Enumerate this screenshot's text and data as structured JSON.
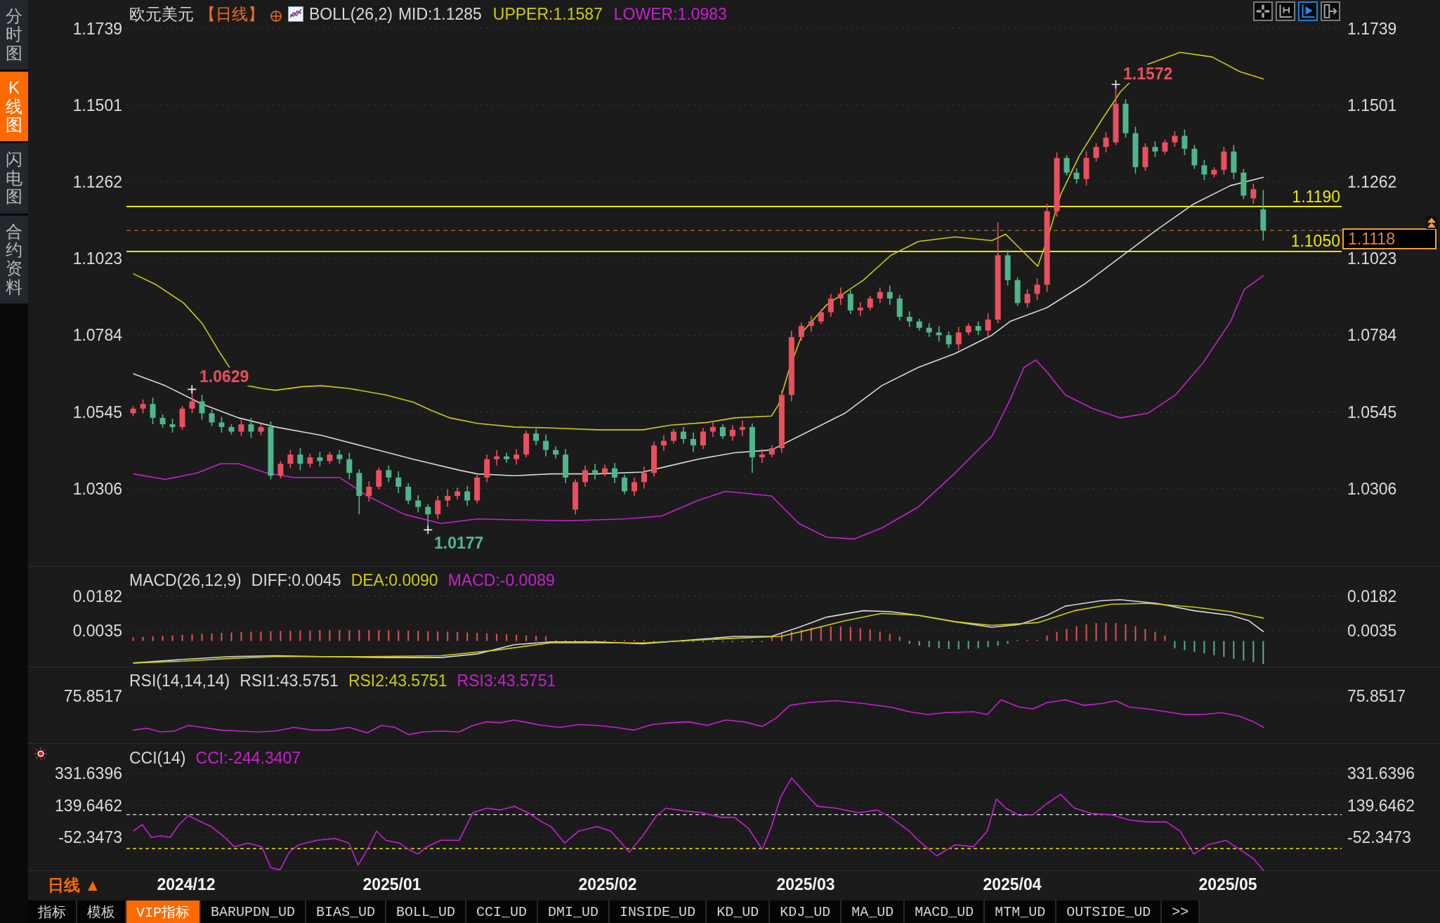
{
  "sidebar": {
    "tabs": [
      {
        "label": "分时图",
        "selected": false
      },
      {
        "label": "K线图",
        "selected": true
      },
      {
        "label": "闪电图",
        "selected": false
      },
      {
        "label": "合约资料",
        "selected": false
      }
    ]
  },
  "price_chart": {
    "symbol": "欧元美元",
    "period": "【日线】",
    "indicator": "BOLL(26,2)",
    "legend": [
      {
        "text": "MID:1.1285",
        "color": "#d8d8d8"
      },
      {
        "text": "UPPER:1.1587",
        "color": "#cccc10"
      },
      {
        "text": "LOWER:1.0983",
        "color": "#c820d0"
      }
    ],
    "toolbar": [
      {
        "selected": false
      },
      {
        "selected": false
      },
      {
        "selected": true
      },
      {
        "selected": false
      }
    ],
    "left_axis": [
      "1.1739",
      "1.1501",
      "1.1262",
      "1.1023",
      "1.0784",
      "1.0545",
      "1.0306"
    ],
    "right_axis": [
      "1.1739",
      "1.1501",
      "1.1262",
      "1.1023",
      "1.0784",
      "1.0545",
      "1.0306"
    ],
    "annotations": [
      {
        "text": "1.1572",
        "kind": "high"
      },
      {
        "text": "1.0629",
        "kind": "high"
      },
      {
        "text": "1.0177",
        "kind": "low"
      }
    ],
    "levels": [
      "1.1190",
      "1.1050"
    ],
    "current_price": "1.1118"
  },
  "macd": {
    "title": "MACD(26,12,9)",
    "legend": [
      {
        "text": "DIFF:0.0045",
        "color": "#d8d8d8"
      },
      {
        "text": "DEA:0.0090",
        "color": "#cccc10"
      },
      {
        "text": "MACD:-0.0089",
        "color": "#c820d0"
      }
    ],
    "left_axis": [
      "0.0182",
      "0.0035"
    ],
    "right_axis": [
      "0.0182",
      "0.0035"
    ]
  },
  "rsi": {
    "title": "RSI(14,14,14)",
    "legend": [
      {
        "text": "RSI1:43.5751",
        "color": "#d8d8d8"
      },
      {
        "text": "RSI2:43.5751",
        "color": "#cccc10"
      },
      {
        "text": "RSI3:43.5751",
        "color": "#c820d0"
      }
    ],
    "left_axis": [
      "75.8517"
    ],
    "right_axis": [
      "75.8517"
    ]
  },
  "cci": {
    "title": "CCI(14)",
    "legend": [
      {
        "text": "CCI:-244.3407",
        "color": "#c820d0"
      }
    ],
    "left_axis": [
      "331.6396",
      "139.6462",
      "-52.3473"
    ],
    "right_axis": [
      "331.6396",
      "139.6462",
      "-52.3473"
    ]
  },
  "date_axis": {
    "period": "日线 ▲",
    "labels": [
      "2024/12",
      "2025/01",
      "2025/02",
      "2025/03",
      "2025/04",
      "2025/05"
    ]
  },
  "indicator_tabs": {
    "tabs": [
      {
        "label": "指标",
        "selected": false
      },
      {
        "label": "模板",
        "selected": false
      },
      {
        "label": "VIP指标",
        "selected": true
      },
      {
        "label": "BARUPDN_UD",
        "selected": false
      },
      {
        "label": "BIAS_UD",
        "selected": false
      },
      {
        "label": "BOLL_UD",
        "selected": false
      },
      {
        "label": "CCI_UD",
        "selected": false
      },
      {
        "label": "DMI_UD",
        "selected": false
      },
      {
        "label": "INSIDE_UD",
        "selected": false
      },
      {
        "label": "KD_UD",
        "selected": false
      },
      {
        "label": "KDJ_UD",
        "selected": false
      },
      {
        "label": "MA_UD",
        "selected": false
      },
      {
        "label": "MACD_UD",
        "selected": false
      },
      {
        "label": "MTM_UD",
        "selected": false
      },
      {
        "label": "OUTSIDE_UD",
        "selected": false
      }
    ],
    "more": ">>"
  }
}
